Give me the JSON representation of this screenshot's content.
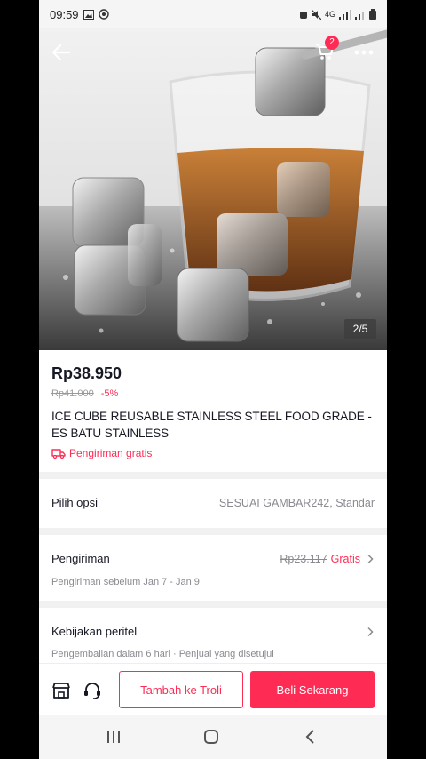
{
  "status_bar": {
    "time": "09:59",
    "network": "4G"
  },
  "header": {
    "cart_count": "2",
    "image_counter": "2/5"
  },
  "product": {
    "price": "Rp38.950",
    "original_price": "Rp41.000",
    "discount": "-5%",
    "title": "ICE CUBE REUSABLE STAINLESS STEEL FOOD GRADE - ES BATU STAINLESS",
    "free_shipping": "Pengiriman gratis"
  },
  "options": {
    "label": "Pilih opsi",
    "value": "SESUAI GAMBAR242, Standar"
  },
  "shipping": {
    "label": "Pengiriman",
    "original_cost": "Rp23.117",
    "cost": "Gratis",
    "eta": "Pengiriman sebelum Jan 7 - Jan 9"
  },
  "policy": {
    "label": "Kebijakan peritel",
    "detail": "Pengembalian dalam 6 hari · Penjual yang disetujui"
  },
  "actions": {
    "add_to_cart": "Tambah ke Troli",
    "buy_now": "Beli Sekarang"
  },
  "colors": {
    "accent": "#fe2c55",
    "text": "#161823",
    "muted": "#8a8b91"
  }
}
